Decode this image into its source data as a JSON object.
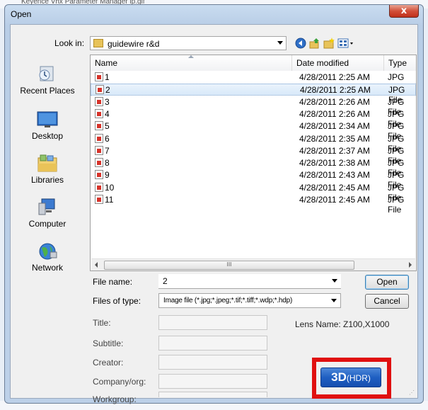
{
  "dialog": {
    "title": "Open",
    "close_label": "x"
  },
  "look_in": {
    "label": "Look in:",
    "value": "guidewire r&d"
  },
  "places": [
    {
      "label": "Recent Places",
      "icon": "recent-places-icon"
    },
    {
      "label": "Desktop",
      "icon": "desktop-icon"
    },
    {
      "label": "Libraries",
      "icon": "libraries-icon"
    },
    {
      "label": "Computer",
      "icon": "computer-icon"
    },
    {
      "label": "Network",
      "icon": "network-icon"
    }
  ],
  "columns": {
    "name": "Name",
    "date": "Date modified",
    "type": "Type"
  },
  "files": [
    {
      "name": "1",
      "date": "4/28/2011 2:25 AM",
      "type": "JPG File"
    },
    {
      "name": "2",
      "date": "4/28/2011 2:25 AM",
      "type": "JPG File"
    },
    {
      "name": "3",
      "date": "4/28/2011 2:26 AM",
      "type": "JPG File"
    },
    {
      "name": "4",
      "date": "4/28/2011 2:26 AM",
      "type": "JPG File"
    },
    {
      "name": "5",
      "date": "4/28/2011 2:34 AM",
      "type": "JPG File"
    },
    {
      "name": "6",
      "date": "4/28/2011 2:35 AM",
      "type": "JPG File"
    },
    {
      "name": "7",
      "date": "4/28/2011 2:37 AM",
      "type": "JPG File"
    },
    {
      "name": "8",
      "date": "4/28/2011 2:38 AM",
      "type": "JPG File"
    },
    {
      "name": "9",
      "date": "4/28/2011 2:43 AM",
      "type": "JPG File"
    },
    {
      "name": "10",
      "date": "4/28/2011 2:45 AM",
      "type": "JPG File"
    },
    {
      "name": "11",
      "date": "4/28/2011 2:45 AM",
      "type": "JPG File"
    }
  ],
  "selected_index": 1,
  "file_name": {
    "label": "File name:",
    "value": "2"
  },
  "file_type": {
    "label": "Files of type:",
    "value": "Image file (*.jpg;*.jpeg;*.tif;*.tiff;*.wdp;*.hdp)"
  },
  "buttons": {
    "open": "Open",
    "cancel": "Cancel"
  },
  "meta": {
    "title": "Title:",
    "subtitle": "Subtitle:",
    "creator": "Creator:",
    "company": "Company/org:",
    "workgroup": "Workgroup:"
  },
  "lens": {
    "label": "Lens Name:",
    "value": "Z100,X1000"
  },
  "hdr_button": {
    "main": "3D",
    "sub": "(HDR)"
  },
  "background_text": "Keyence Vhx Parameter Manager ip.gif",
  "scroll_grip": "III",
  "colors": {
    "highlight": "#e01010",
    "hdr_button": "#1f5fc2",
    "selection": "#d8e9f9"
  }
}
